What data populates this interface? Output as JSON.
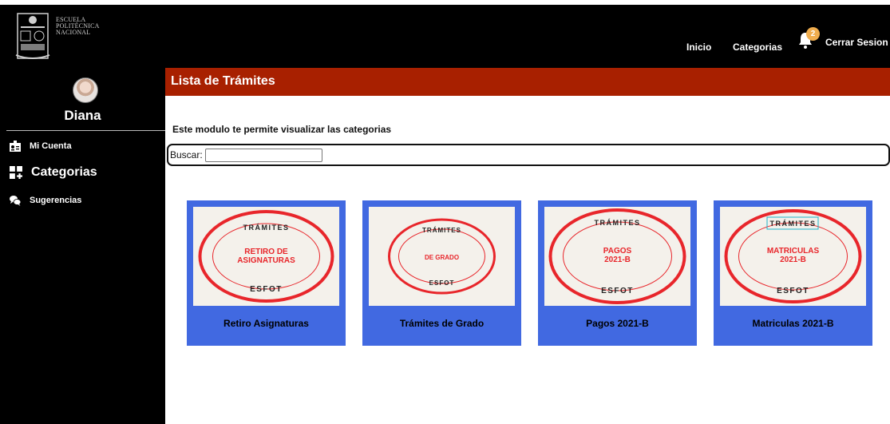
{
  "brand": {
    "logo_lines": [
      "ESCUELA",
      "POLITÉCNICA",
      "NACIONAL"
    ]
  },
  "nav": {
    "inicio": "Inicio",
    "categorias": "Categorias",
    "notifications_count": "2",
    "logout": "Cerrar Sesion"
  },
  "sidebar": {
    "username": "Diana",
    "items": [
      {
        "label": "Mi Cuenta",
        "icon": "id-card-icon"
      },
      {
        "label": "Categorias",
        "icon": "grid-plus-icon"
      },
      {
        "label": "Sugerencias",
        "icon": "chat-bubbles-icon"
      }
    ]
  },
  "main": {
    "title": "Lista de Trámites",
    "subtitle": "Este modulo te permite visualizar las categorias",
    "search_label": "Buscar:",
    "search_value": ""
  },
  "cards": [
    {
      "stamp_top": "TRÁMITES",
      "stamp_middle_1": "RETIRO DE",
      "stamp_middle_2": "ASIGNATURAS",
      "stamp_bottom": "ESFOT",
      "title": "Retiro Asignaturas"
    },
    {
      "stamp_top": "TRÁMITES",
      "stamp_middle_1": "DE GRADO",
      "stamp_middle_2": "",
      "stamp_bottom": "ESFOT",
      "title": "Trámites de Grado"
    },
    {
      "stamp_top": "TRÁMITES",
      "stamp_middle_1": "PAGOS",
      "stamp_middle_2": "2021-B",
      "stamp_bottom": "ESFOT",
      "title": "Pagos 2021-B"
    },
    {
      "stamp_top": "TRÁMITES",
      "stamp_middle_1": "MATRICULAS",
      "stamp_middle_2": "2021-B",
      "stamp_bottom": "ESFOT",
      "title": "Matriculas 2021-B"
    }
  ],
  "colors": {
    "topbar": "#000000",
    "header": "#a82000",
    "card": "#4169e1",
    "stamp_red": "#e8262b",
    "badge": "#f0ad4e"
  }
}
